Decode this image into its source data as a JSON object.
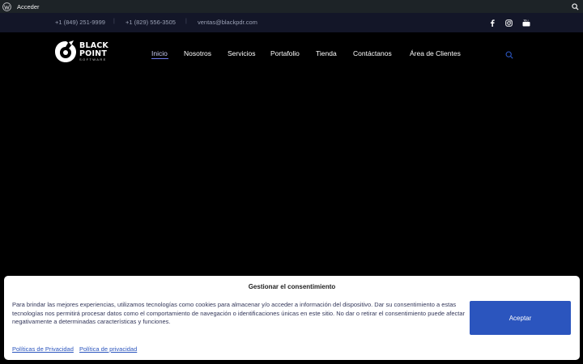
{
  "admin_bar": {
    "login_label": "Acceder"
  },
  "topbar": {
    "phone_1": "+1 (849) 251-9999",
    "phone_2": "+1 (829) 556-3505",
    "email": "ventas@blackpdr.com",
    "separator": "|",
    "social_icons": [
      "facebook-icon",
      "instagram-icon",
      "youtube-icon"
    ]
  },
  "logo": {
    "line1": "BLACK",
    "line2": "POINT",
    "line3": "SOFTWARE"
  },
  "nav": {
    "items": [
      {
        "label": "Inicio",
        "active": true
      },
      {
        "label": "Nosotros"
      },
      {
        "label": "Servicios"
      },
      {
        "label": "Portafolio"
      },
      {
        "label": "Tienda"
      },
      {
        "label": "Contáctanos"
      },
      {
        "label": "Área de Clientes"
      }
    ]
  },
  "cookie": {
    "title": "Gestionar el consentimiento",
    "text": "Para brindar las mejores experiencias, utilizamos tecnologías como cookies para almacenar y/o acceder a información del dispositivo. Dar su consentimiento a estas tecnologías nos permitirá procesar datos como el comportamiento de navegación o identificaciones únicas en este sitio. No dar o retirar el consentimiento puede afectar negativamente a determinadas características y funciones.",
    "accept_label": "Aceptar",
    "link_1": "Políticas de Privacidad",
    "link_2": "Política de privacidad"
  },
  "colors": {
    "admin_bar_bg": "#1d2327",
    "topbar_bg": "#131628",
    "accept_button": "#2b55be",
    "nav_active_underline": "#6e79e8"
  }
}
